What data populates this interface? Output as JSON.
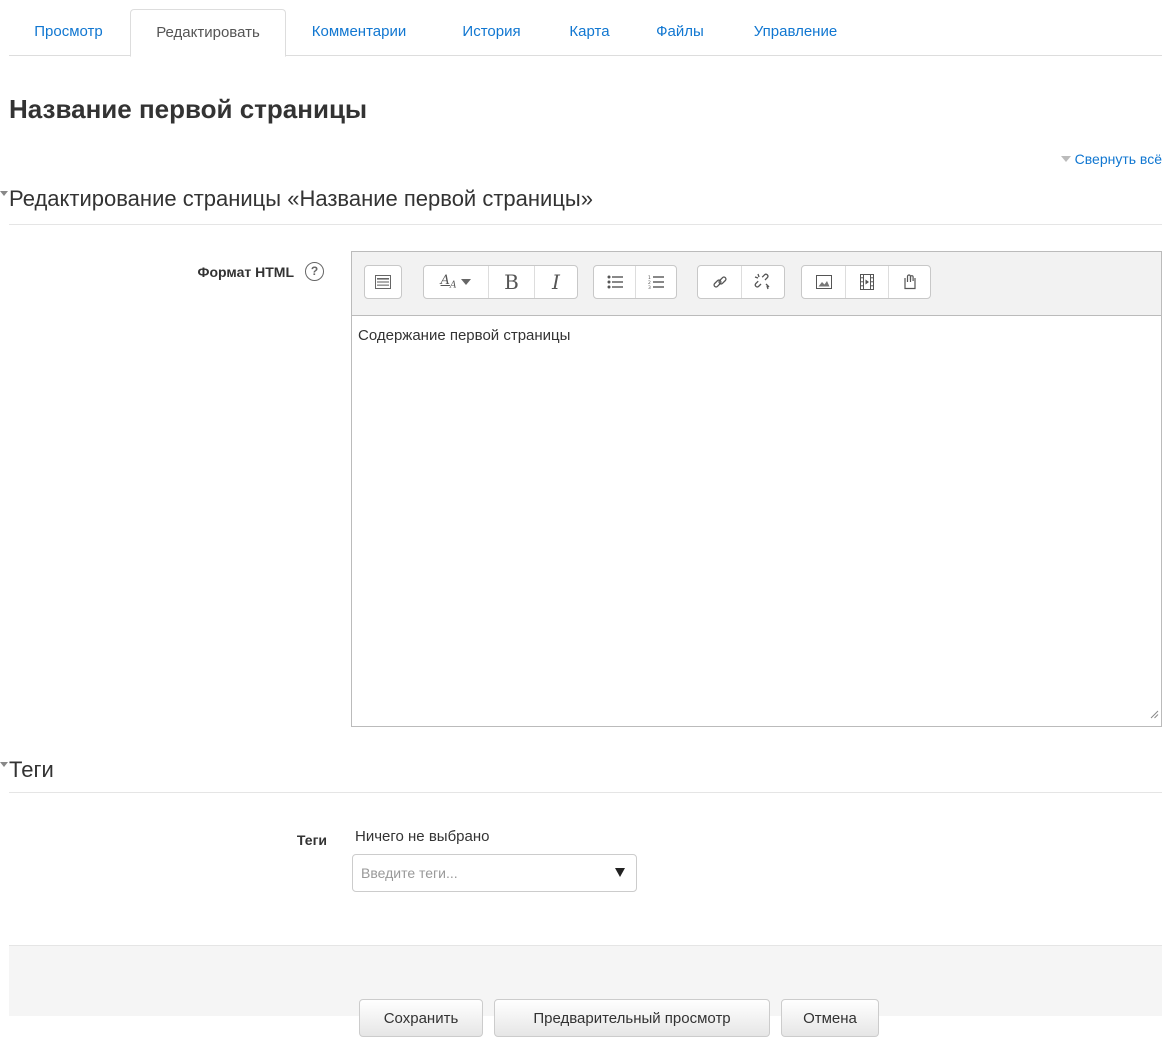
{
  "tabs": [
    {
      "label": "Просмотр",
      "active": false
    },
    {
      "label": "Редактировать",
      "active": true
    },
    {
      "label": "Комментарии",
      "active": false
    },
    {
      "label": "История",
      "active": false
    },
    {
      "label": "Карта",
      "active": false
    },
    {
      "label": "Файлы",
      "active": false
    },
    {
      "label": "Управление",
      "active": false
    }
  ],
  "page_title": "Название первой страницы",
  "collapse_all": "Свернуть всё",
  "section_edit": {
    "legend": "Редактирование страницы «Название первой страницы»",
    "format_label": "Формат HTML",
    "help_icon": "?",
    "editor": {
      "toolbar_groups": [
        [
          "toggle-toolbar-icon"
        ],
        [
          "font-style-icon",
          "bold-icon",
          "italic-icon"
        ],
        [
          "unordered-list-icon",
          "ordered-list-icon"
        ],
        [
          "link-icon",
          "unlink-icon"
        ],
        [
          "image-icon",
          "media-icon",
          "manage-files-icon"
        ]
      ],
      "content": "Содержание первой страницы"
    }
  },
  "section_tags": {
    "legend": "Теги",
    "label": "Теги",
    "selected": "Ничего не выбрано",
    "placeholder": "Введите теги..."
  },
  "buttons": {
    "save": "Сохранить",
    "preview": "Предварительный просмотр",
    "cancel": "Отмена"
  },
  "colors": {
    "link": "#1177d1",
    "border": "#dddddd",
    "footer_bg": "#f5f5f5"
  }
}
